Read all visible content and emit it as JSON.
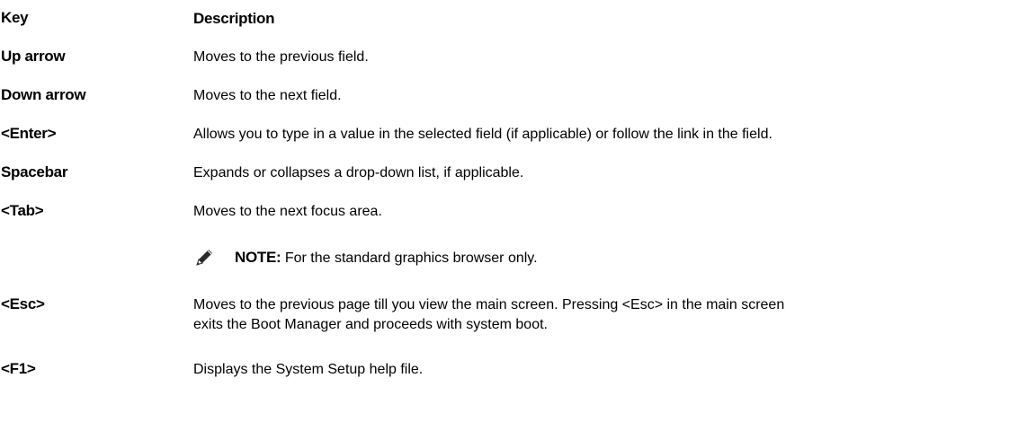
{
  "table": {
    "header": {
      "key": "Key",
      "description": "Description"
    },
    "rows": [
      {
        "key": "Up arrow",
        "description": "Moves to the previous field."
      },
      {
        "key": "Down arrow",
        "description": "Moves to the next field."
      },
      {
        "key": "<Enter>",
        "description": "Allows you to type in a value in the selected field (if applicable) or follow the link in the field."
      },
      {
        "key": "Spacebar",
        "description": "Expands or collapses a drop-down list, if applicable."
      },
      {
        "key": "<Tab>",
        "description": "Moves to the next focus area."
      },
      {
        "key": "<Esc>",
        "description_line1": "Moves to the previous page till you view the main screen. Pressing <Esc> in the main screen",
        "description_line2": "exits the Boot Manager and proceeds with system boot."
      },
      {
        "key": "<F1>",
        "description": "Displays the System Setup help file."
      }
    ],
    "note": {
      "label": "NOTE:",
      "text": " For the standard graphics browser only.",
      "icon": "note-pencil-icon"
    }
  }
}
